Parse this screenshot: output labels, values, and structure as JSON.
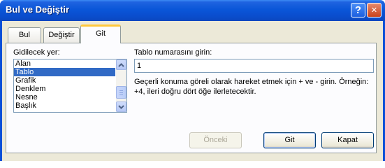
{
  "window": {
    "title": "Bul ve Değiştir",
    "help_glyph": "?",
    "close_glyph": "✕"
  },
  "tabs": [
    {
      "label": "Bul",
      "active": false
    },
    {
      "label": "Değiştir",
      "active": false
    },
    {
      "label": "Git",
      "active": true
    }
  ],
  "goto": {
    "list_label": "Gidilecek yer:",
    "list_items": [
      "Alan",
      "Tablo",
      "Grafik",
      "Denklem",
      "Nesne",
      "Başlık"
    ],
    "selected_item": "Tablo",
    "input_label": "Tablo numarasını girin:",
    "input_value": "1",
    "description": "Geçerli konuma göreli olarak hareket etmek için + ve - girin. Örneğin: +4, ileri doğru dört öğe ilerletecektir."
  },
  "buttons": {
    "previous": "Önceki",
    "go": "Git",
    "close": "Kapat"
  },
  "colors": {
    "titlebar": "#0a56d8",
    "selection": "#316ac5",
    "tab_highlight": "#ffc83c",
    "dialog_bg": "#ece9d8"
  },
  "icons": {
    "help": "help-icon",
    "close": "close-icon",
    "scroll_up": "chevron-up-icon",
    "scroll_down": "chevron-down-icon"
  }
}
